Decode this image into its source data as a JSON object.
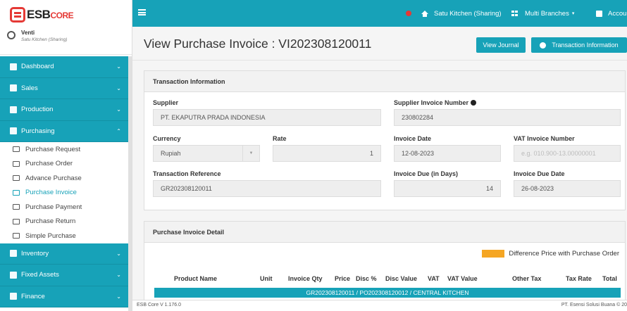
{
  "brand": {
    "name": "ESB",
    "suffix": "CORE"
  },
  "user": {
    "name": "Venti",
    "branch": "Satu Kitchen (Sharing)"
  },
  "sidebar": {
    "items": [
      {
        "label": "Dashboard",
        "icon": "dashboard-icon"
      },
      {
        "label": "Sales",
        "icon": "sales-icon"
      },
      {
        "label": "Production",
        "icon": "production-icon"
      },
      {
        "label": "Purchasing",
        "icon": "purchasing-icon"
      },
      {
        "label": "Inventory",
        "icon": "inventory-icon"
      },
      {
        "label": "Fixed Assets",
        "icon": "fixed-assets-icon"
      },
      {
        "label": "Finance",
        "icon": "finance-icon"
      }
    ],
    "purchasing_sub": [
      "Purchase Request",
      "Purchase Order",
      "Advance Purchase",
      "Purchase Invoice",
      "Purchase Payment",
      "Purchase Return",
      "Simple Purchase"
    ]
  },
  "topbar": {
    "branch": "Satu Kitchen (Sharing)",
    "multi": "Multi Branches",
    "account": "Accoun"
  },
  "page": {
    "title": "View Purchase Invoice : VI202308120011",
    "view_journal": "View Journal",
    "transaction_info_btn": "Transaction Information"
  },
  "transaction": {
    "header": "Transaction Information",
    "supplier_label": "Supplier",
    "supplier_value": "PT. EKAPUTRA PRADA INDONESIA",
    "supplier_invoice_label": "Supplier Invoice Number",
    "supplier_invoice_value": "230802284",
    "currency_label": "Currency",
    "currency_value": "Rupiah",
    "rate_label": "Rate",
    "rate_value": "1",
    "invoice_date_label": "Invoice Date",
    "invoice_date_value": "12-08-2023",
    "vat_label": "VAT Invoice Number",
    "vat_placeholder": "e.g. 010.900-13.00000001",
    "reference_label": "Transaction Reference",
    "reference_value": "GR202308120011",
    "due_days_label": "Invoice Due (in Days)",
    "due_days_value": "14",
    "due_date_label": "Invoice Due Date",
    "due_date_value": "26-08-2023"
  },
  "detail": {
    "header": "Purchase Invoice Detail",
    "legend": "Difference Price with Purchase Order",
    "legend_color": "#f5a623",
    "columns": [
      "Product Name",
      "Unit",
      "Invoice Qty",
      "Price",
      "Disc %",
      "Disc Value",
      "VAT",
      "VAT Value",
      "Other Tax",
      "Tax Rate",
      "Total"
    ],
    "group_row": "GR202308120011 / PO202308120012 / CENTRAL KITCHEN"
  },
  "footer": {
    "version": "ESB Core V 1.176.0",
    "company": "PT. Esensi Solusi Buana © 20"
  },
  "colors": {
    "accent": "#17a2b8",
    "brand_red": "#e53935"
  }
}
